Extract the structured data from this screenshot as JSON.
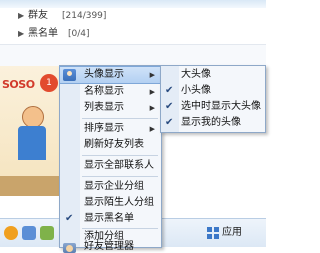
{
  "contact_list": {
    "groups": [
      {
        "name": "群友",
        "count": "[214/399]"
      },
      {
        "name": "黑名单",
        "count": "[0/4]"
      }
    ]
  },
  "banner": {
    "logo": "SOSO",
    "badge": "1"
  },
  "bottom_bar": {
    "apps_label": "应用"
  },
  "context_menu": {
    "items": [
      {
        "label": "头像显示",
        "has_submenu": true,
        "icon": "avatar-display-icon",
        "checked": false,
        "highlighted": true
      },
      {
        "label": "名称显示",
        "has_submenu": true,
        "checked": false
      },
      {
        "label": "列表显示",
        "has_submenu": true,
        "checked": false
      },
      {
        "label": "排序显示",
        "has_submenu": true,
        "checked": false
      },
      {
        "label": "刷新好友列表",
        "has_submenu": false,
        "checked": false
      },
      {
        "label": "显示全部联系人",
        "has_submenu": false,
        "checked": false
      },
      {
        "label": "显示企业分组",
        "has_submenu": false,
        "checked": false
      },
      {
        "label": "显示陌生人分组",
        "has_submenu": false,
        "checked": false
      },
      {
        "label": "显示黑名单",
        "has_submenu": false,
        "checked": true
      },
      {
        "label": "添加分组",
        "has_submenu": false,
        "checked": false
      },
      {
        "label": "好友管理器",
        "has_submenu": false,
        "icon": "friend-manager-icon",
        "checked": false
      }
    ]
  },
  "submenu": {
    "items": [
      {
        "label": "大头像",
        "checked": false
      },
      {
        "label": "小头像",
        "checked": true
      },
      {
        "label": "选中时显示大头像",
        "checked": true
      },
      {
        "label": "显示我的头像",
        "checked": true
      }
    ]
  },
  "colors": {
    "menu_bg": "#f4f7fb",
    "menu_border": "#8ea8c8",
    "highlight": "#b3d0f2",
    "accent": "#2a4c80"
  }
}
